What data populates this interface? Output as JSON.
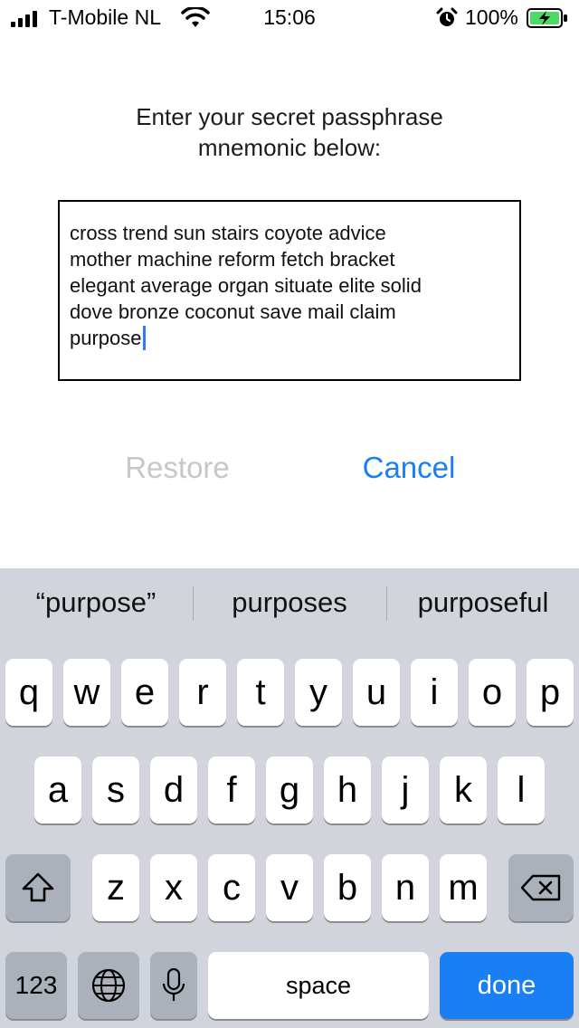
{
  "status": {
    "carrier": "T-Mobile NL",
    "time": "15:06",
    "battery": "100%",
    "icons": [
      "signal-icon",
      "wifi-icon",
      "alarm-icon",
      "battery-charging-icon"
    ]
  },
  "prompt": "Enter your secret passphrase\nmnemonic below:",
  "mnemonic": "cross trend sun stairs coyote advice\nmother machine reform fetch bracket\nelegant average organ situate elite solid\ndove bronze coconut save mail claim\npurpose",
  "buttons": {
    "restore": "Restore",
    "cancel": "Cancel"
  },
  "colors": {
    "accent": "#1a7ff5",
    "disabled": "#c7c7cc",
    "keyboard_bg": "#d1d4da"
  },
  "keyboard": {
    "suggestions": [
      "“purpose”",
      "purposes",
      "purposeful"
    ],
    "row1": [
      "q",
      "w",
      "e",
      "r",
      "t",
      "y",
      "u",
      "i",
      "o",
      "p"
    ],
    "row2": [
      "a",
      "s",
      "d",
      "f",
      "g",
      "h",
      "j",
      "k",
      "l"
    ],
    "row3": [
      "z",
      "x",
      "c",
      "v",
      "b",
      "n",
      "m"
    ],
    "numbers_label": "123",
    "space_label": "space",
    "done_label": "done"
  }
}
